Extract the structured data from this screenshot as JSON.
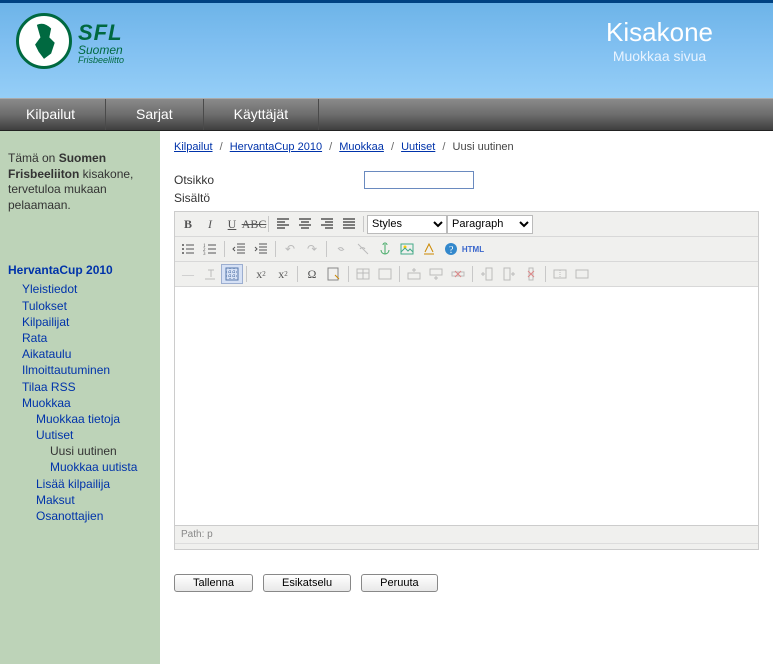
{
  "header": {
    "logo": {
      "sfl": "SFL",
      "suomen": "Suomen",
      "frisbee": "Frisbeeliitto"
    },
    "title": "Kisakone",
    "subtitle": "Muokkaa sivua"
  },
  "topnav": [
    "Kilpailut",
    "Sarjat",
    "Käyttäjät"
  ],
  "sidebar": {
    "intro_prefix": "Tämä on ",
    "intro_bold": "Suomen Frisbeeliiton",
    "intro_rest": " kisakone, tervetuloa mukaan pelaamaan.",
    "comp_title": "HervantaCup 2010",
    "items": {
      "yleis": "Yleistiedot",
      "tulokset": "Tulokset",
      "kilpailijat": "Kilpailijat",
      "rata": "Rata",
      "aikataulu": "Aikataulu",
      "ilmoitt": "Ilmoittautuminen",
      "tilaa": "Tilaa RSS",
      "muokkaa": "Muokkaa",
      "muokkaa_tietoja": "Muokkaa tietoja",
      "uutiset": "Uutiset",
      "uusi_uutinen": "Uusi uutinen",
      "muokkaa_uutista": "Muokkaa uutista",
      "lisaa_kilpailija": "Lisää kilpailija",
      "maksut": "Maksut",
      "osanottajien": "Osanottajien"
    }
  },
  "breadcrumb": {
    "a": "Kilpailut",
    "b": "HervantaCup 2010",
    "c": "Muokkaa",
    "d": "Uutiset",
    "current": "Uusi uutinen"
  },
  "form": {
    "otsikko_label": "Otsikko",
    "otsikko_value": "",
    "sisalto_label": "Sisältö"
  },
  "editor": {
    "styles": "Styles",
    "paragraph": "Paragraph",
    "path_label": "Path: p",
    "html": "HTML"
  },
  "buttons": {
    "save": "Tallenna",
    "preview": "Esikatselu",
    "cancel": "Peruuta"
  }
}
